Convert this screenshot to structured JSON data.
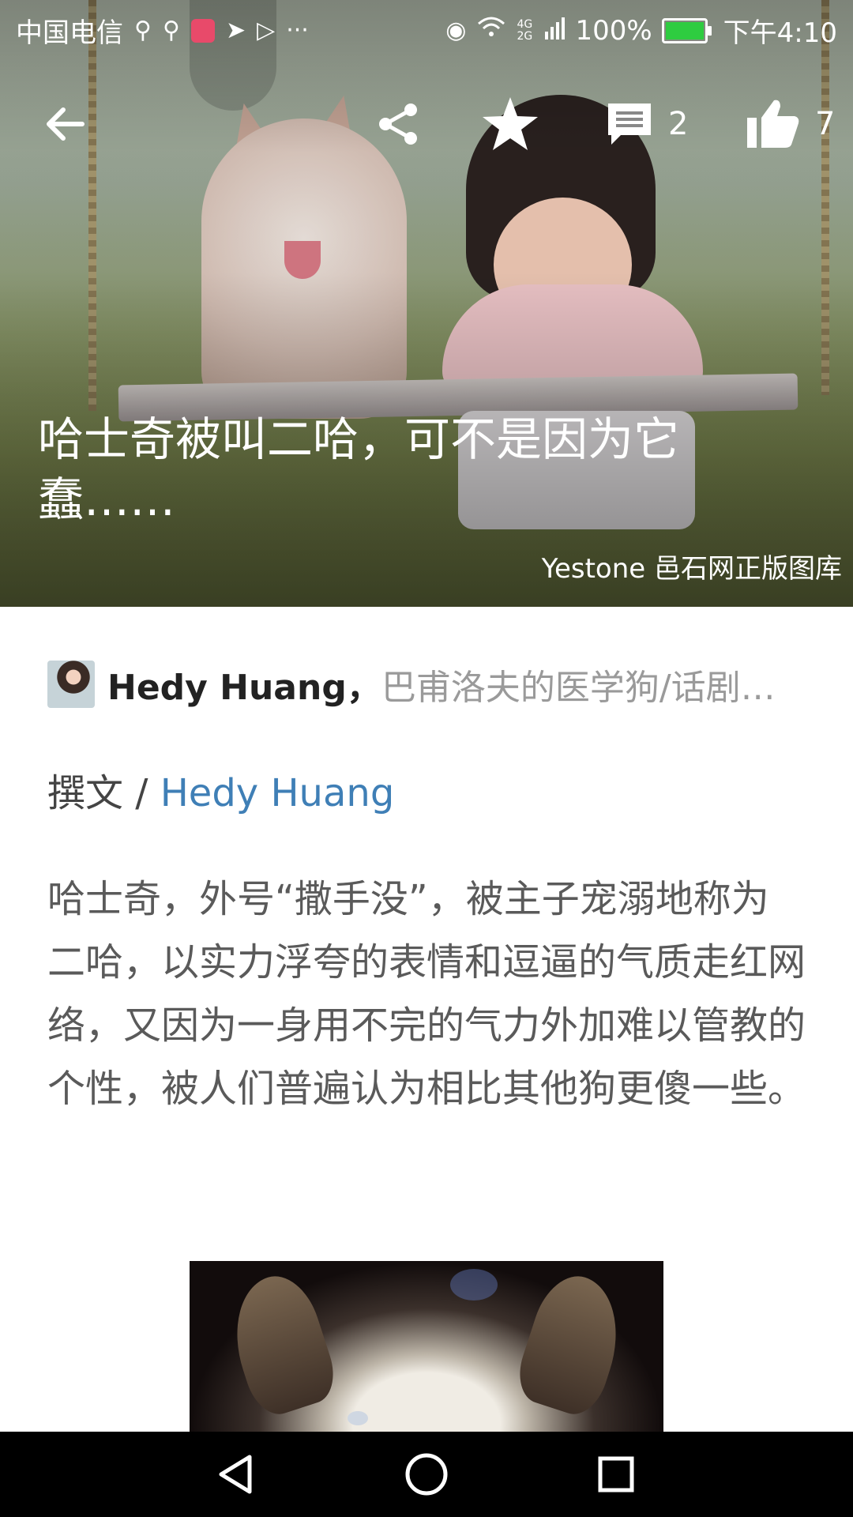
{
  "status_bar": {
    "carrier": "中国电信",
    "extra_icons": [
      "usb-icon",
      "usb-icon",
      "app-icon",
      "telegram-icon",
      "play-icon",
      "more-dots-icon"
    ],
    "more_glyph": "···",
    "network": "4G 2G",
    "battery_percent": "100%",
    "time": "下午4:10"
  },
  "toolbar": {
    "comments_count": "2",
    "likes_count": "7"
  },
  "hero": {
    "title": "哈士奇被叫二哈，可不是因为它蠢……",
    "credit": "Yestone 邑石网正版图库"
  },
  "author": {
    "name": "Hedy Huang，",
    "bio": "巴甫洛夫的医学狗/话剧…"
  },
  "byline": {
    "prefix": "撰文 / ",
    "author_link": "Hedy Huang"
  },
  "article": {
    "paragraph_1": "哈士奇，外号“撒手没”，被主子宠溺地称为二哈，以实力浮夸的表情和逗逼的气质走红网络，又因为一身用不完的气力外加难以管教的个性，被人们普遍认为相比其他狗更傻一些。"
  },
  "colors": {
    "link": "#3f7fb6",
    "body_text": "#5a5a5a",
    "battery_fill": "#2ecc40"
  }
}
